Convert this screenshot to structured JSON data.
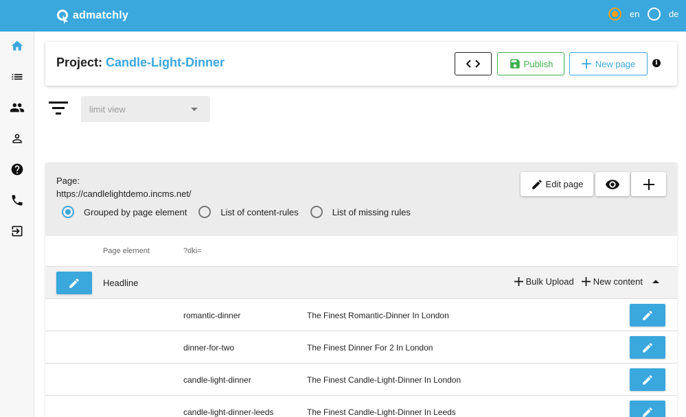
{
  "app": {
    "name": "admatchly"
  },
  "colors": {
    "accent": "#3aa7dd",
    "publish": "#3db04b",
    "lang_selected": "#f0a020"
  },
  "languages": [
    {
      "code": "en",
      "selected": true
    },
    {
      "code": "de",
      "selected": false
    }
  ],
  "nav": {
    "items": [
      {
        "icon": "home-icon",
        "active": true
      },
      {
        "icon": "list-icon"
      },
      {
        "icon": "people-icon"
      },
      {
        "icon": "person-icon"
      },
      {
        "icon": "help-icon"
      },
      {
        "icon": "phone-icon"
      },
      {
        "icon": "logout-icon"
      }
    ]
  },
  "project": {
    "label": "Project: ",
    "name": "Candle-Light-Dinner",
    "code_button": "<>",
    "publish_label": "Publish",
    "new_page_label": "New page",
    "info": "i"
  },
  "filter": {
    "placeholder": "limit view"
  },
  "page": {
    "label": "Page:",
    "url": "https://candlelightdemo.incms.net/",
    "edit_label": "Edit page",
    "view_modes": [
      {
        "label": "Grouped by page element",
        "selected": true
      },
      {
        "label": "List of content-rules",
        "selected": false
      },
      {
        "label": "List of missing rules",
        "selected": false
      }
    ]
  },
  "table": {
    "headers": {
      "element": "Page element",
      "param": "?dki="
    },
    "group": {
      "name": "Headline",
      "bulk_upload": "Bulk Upload",
      "new_content": "New content"
    },
    "rows": [
      {
        "key": "romantic-dinner",
        "value": "The Finest Romantic-Dinner In London"
      },
      {
        "key": "dinner-for-two",
        "value": "The Finest Dinner For 2 In London"
      },
      {
        "key": "candle-light-dinner",
        "value": "The Finest Candle-Light-Dinner In London"
      },
      {
        "key": "candle-light-dinner-leeds",
        "value": "The Finest Candle-Light-Dinner In Leeds"
      }
    ]
  }
}
